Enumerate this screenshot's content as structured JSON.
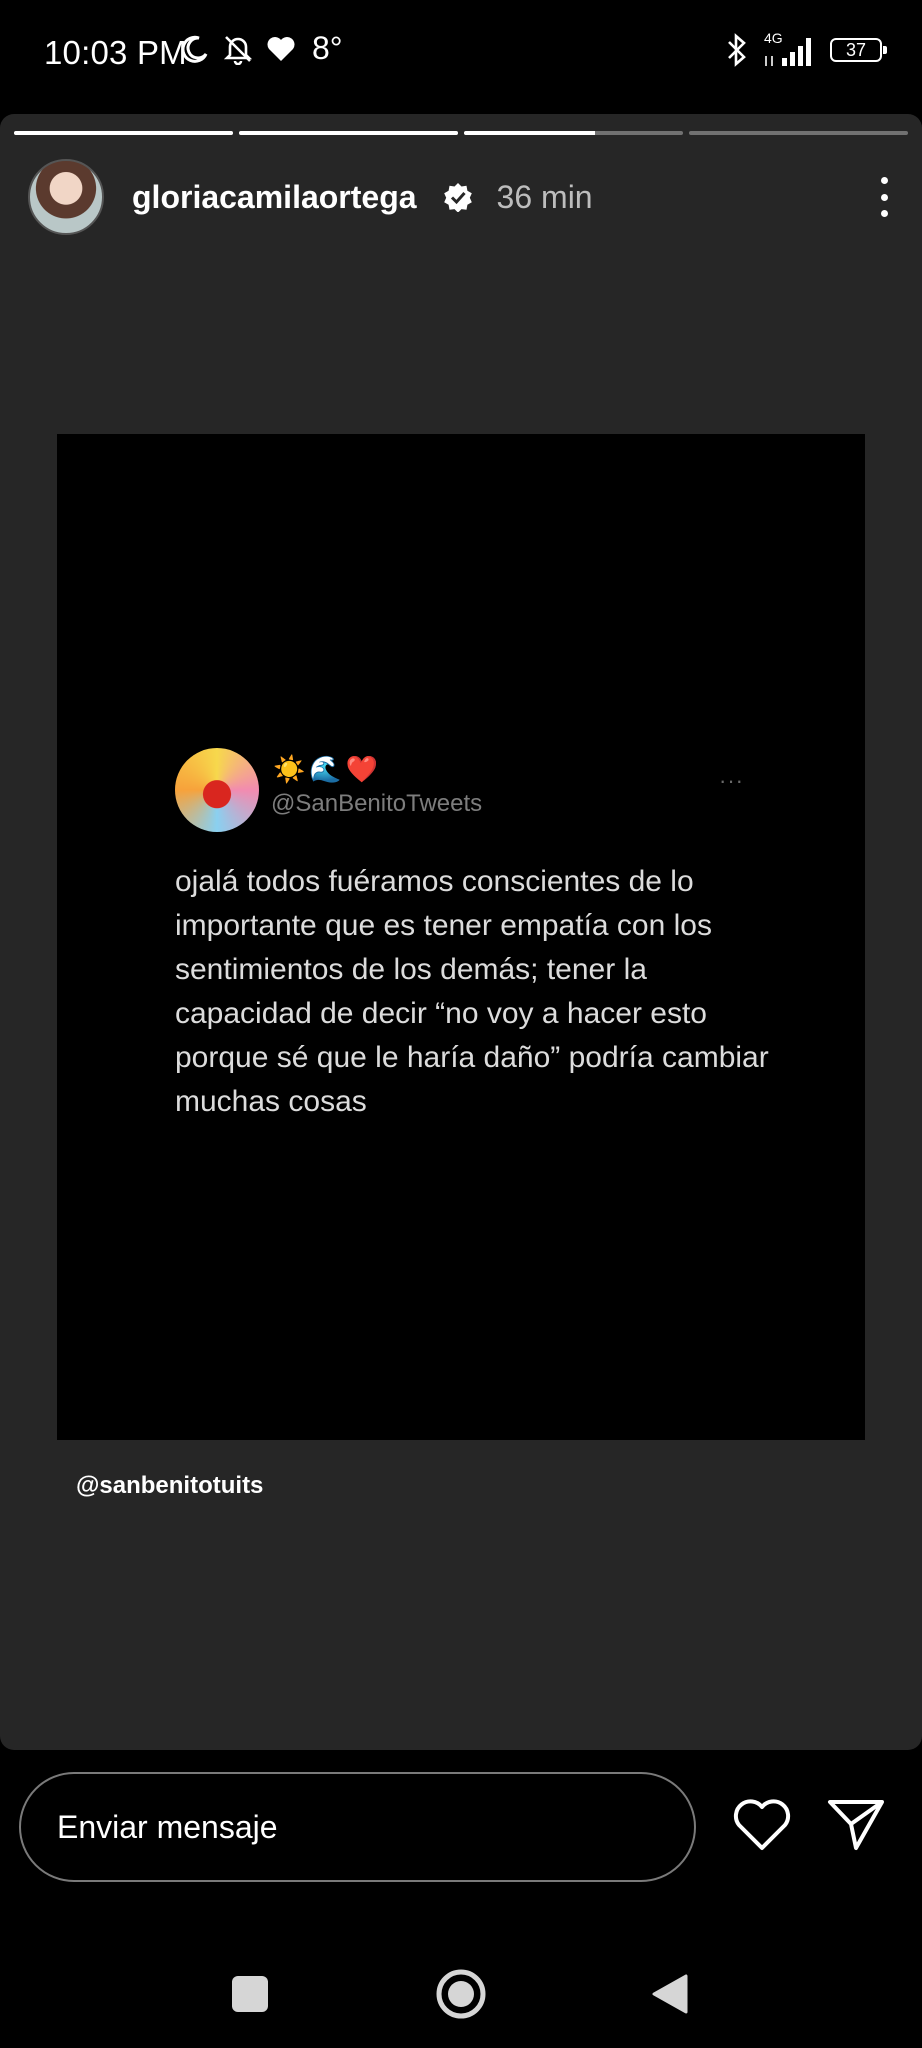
{
  "status_bar": {
    "time": "10:03 PM",
    "temperature": "8°",
    "network": "4G",
    "battery": "37"
  },
  "story": {
    "progress": [
      1.0,
      1.0,
      0.6,
      0.0
    ],
    "username": "gloriacamilaortega",
    "time_ago": "36 min",
    "tweet": {
      "emojis": [
        "☀️",
        "🌊",
        "❤️"
      ],
      "handle": "@SanBenitoTweets",
      "more": "···",
      "text": "ojalá todos fuéramos conscientes de lo importante que es tener empatía con los sentimientos de los demás; tener la capacidad de decir “no voy a hacer esto porque sé que le haría daño” podría cambiar muchas cosas"
    },
    "caption": "@sanbenitotuits"
  },
  "reply_bar": {
    "placeholder": "Enviar mensaje"
  },
  "icons": [
    "moon-icon",
    "bell-off-icon",
    "heart-icon",
    "bluetooth-icon",
    "signal-icon",
    "battery-icon",
    "verified-icon",
    "more-icon",
    "like-icon",
    "send-icon",
    "recents-icon",
    "home-icon",
    "back-icon"
  ]
}
